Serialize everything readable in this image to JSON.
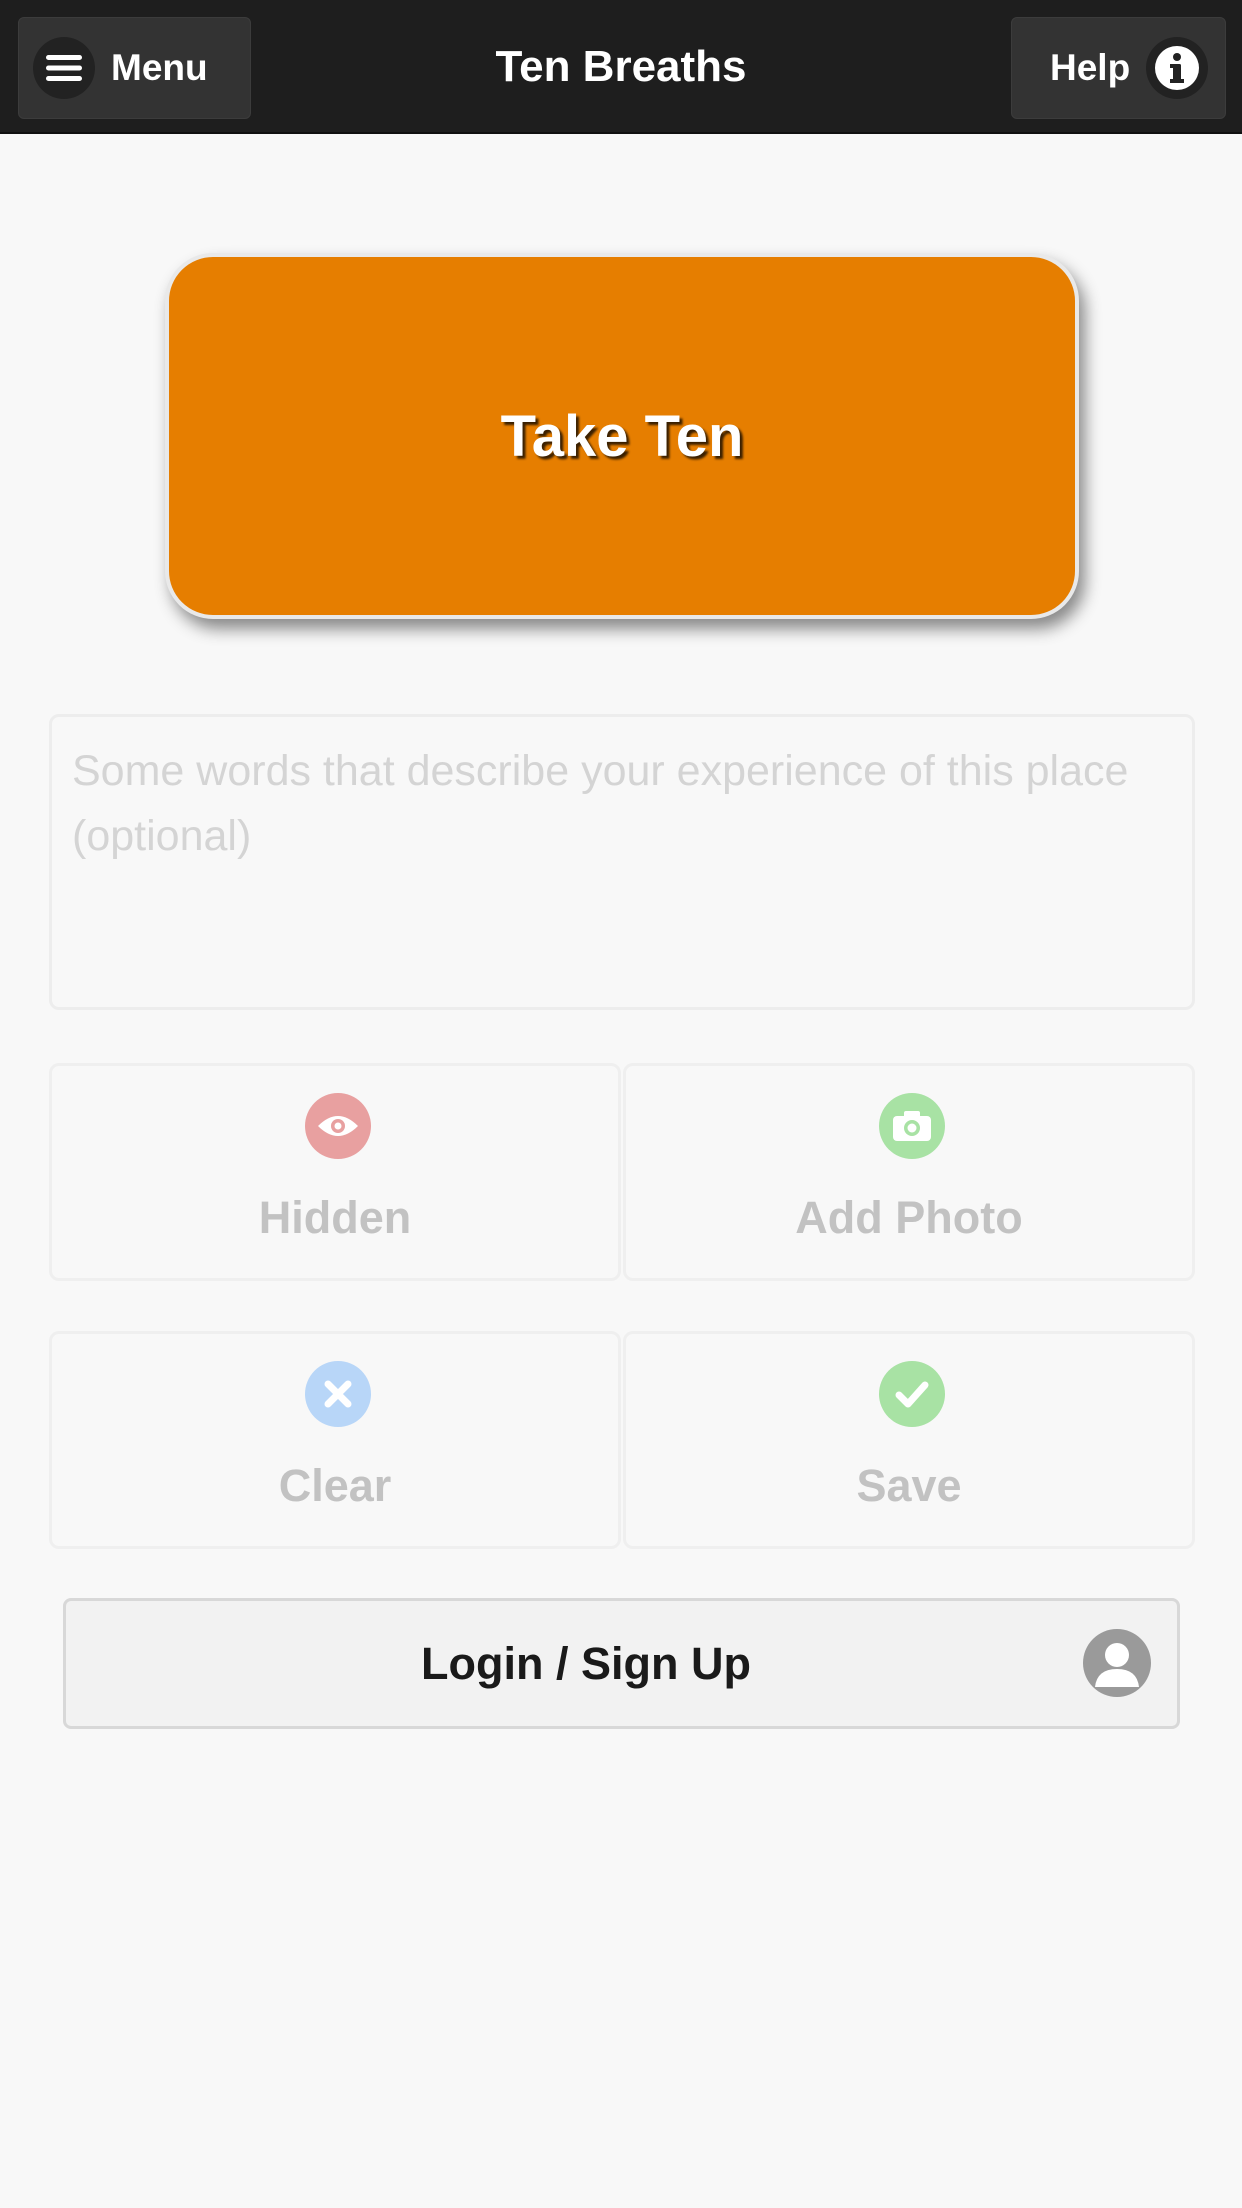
{
  "header": {
    "title": "Ten Breaths",
    "menu_label": "Menu",
    "help_label": "Help",
    "menu_icon": "hamburger-icon",
    "help_icon": "info-icon"
  },
  "main": {
    "take_ten_label": "Take Ten",
    "take_ten_color": "#e67e00",
    "notes": {
      "placeholder": "Some words that describe your experience of this place (optional)",
      "value": ""
    },
    "actions": {
      "hidden": {
        "label": "Hidden",
        "icon": "eye-icon",
        "color": "#e8a0a0"
      },
      "add_photo": {
        "label": "Add Photo",
        "icon": "camera-icon",
        "color": "#a8e2a4"
      },
      "clear": {
        "label": "Clear",
        "icon": "close-icon",
        "color": "#b8d6f8"
      },
      "save": {
        "label": "Save",
        "icon": "check-icon",
        "color": "#a8e2a4"
      }
    },
    "login": {
      "label": "Login / Sign Up",
      "icon": "user-icon"
    }
  }
}
